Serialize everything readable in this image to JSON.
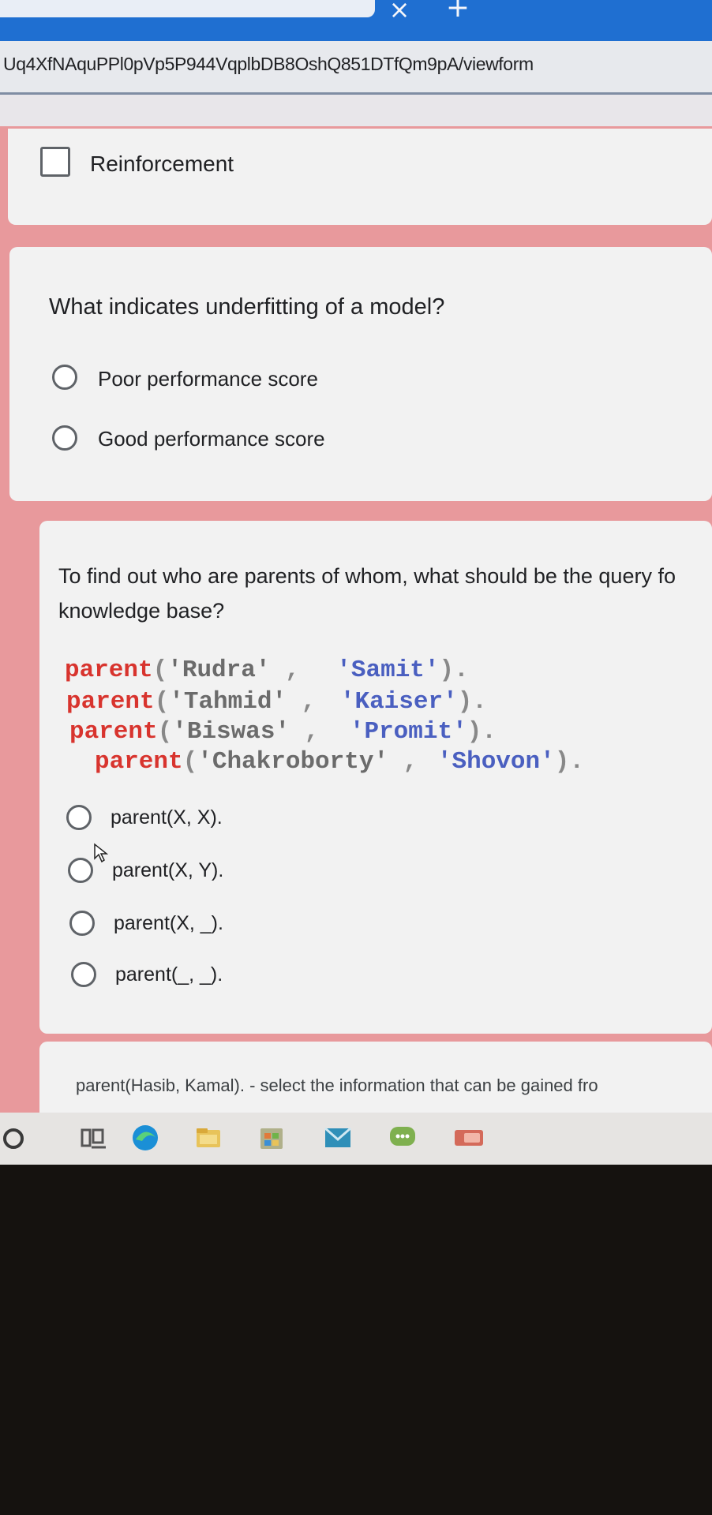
{
  "browser": {
    "url": "Uq4XfNAquPPl0pVp5P944VqplbDB8OshQ851DTfQm9pA/viewform",
    "close_tab_glyph": "×",
    "new_tab_glyph": "+"
  },
  "form": {
    "checkbox_option": {
      "label": "Reinforcement",
      "checked": false
    },
    "question_1": {
      "text": "What indicates underfitting of a model?",
      "options": [
        "Poor performance score",
        "Good performance score"
      ]
    },
    "question_2": {
      "text": "To find out who are parents of whom, what should be the query fo knowledge base?",
      "knowledge_base": [
        {
          "fn": "parent",
          "arg1": "'Rudra'",
          "arg2": "'Samit'"
        },
        {
          "fn": "parent",
          "arg1": "'Tahmid'",
          "arg2": "'Kaiser'"
        },
        {
          "fn": "parent",
          "arg1": "'Biswas'",
          "arg2": "'Promit'"
        },
        {
          "fn": "parent",
          "arg1": "'Chakroborty'",
          "arg2": "'Shovon'"
        }
      ],
      "options": [
        "parent(X, X).",
        "parent(X, Y).",
        "parent(X, _).",
        "parent(_, _)."
      ]
    },
    "question_3": {
      "text": "parent(Hasib, Kamal). - select the information that can be gained fro"
    }
  },
  "taskbar": {
    "icons": [
      "start-icon",
      "task-view-icon",
      "edge-icon",
      "file-explorer-icon",
      "store-icon",
      "mail-icon",
      "messenger-icon",
      "app-icon"
    ]
  },
  "colors": {
    "tabbar": "#1f6fd1",
    "page_bg": "#e8999c",
    "card_bg": "#f2f2f2",
    "kb_function": "#d8342e",
    "kb_string": "#4a5fc0"
  }
}
